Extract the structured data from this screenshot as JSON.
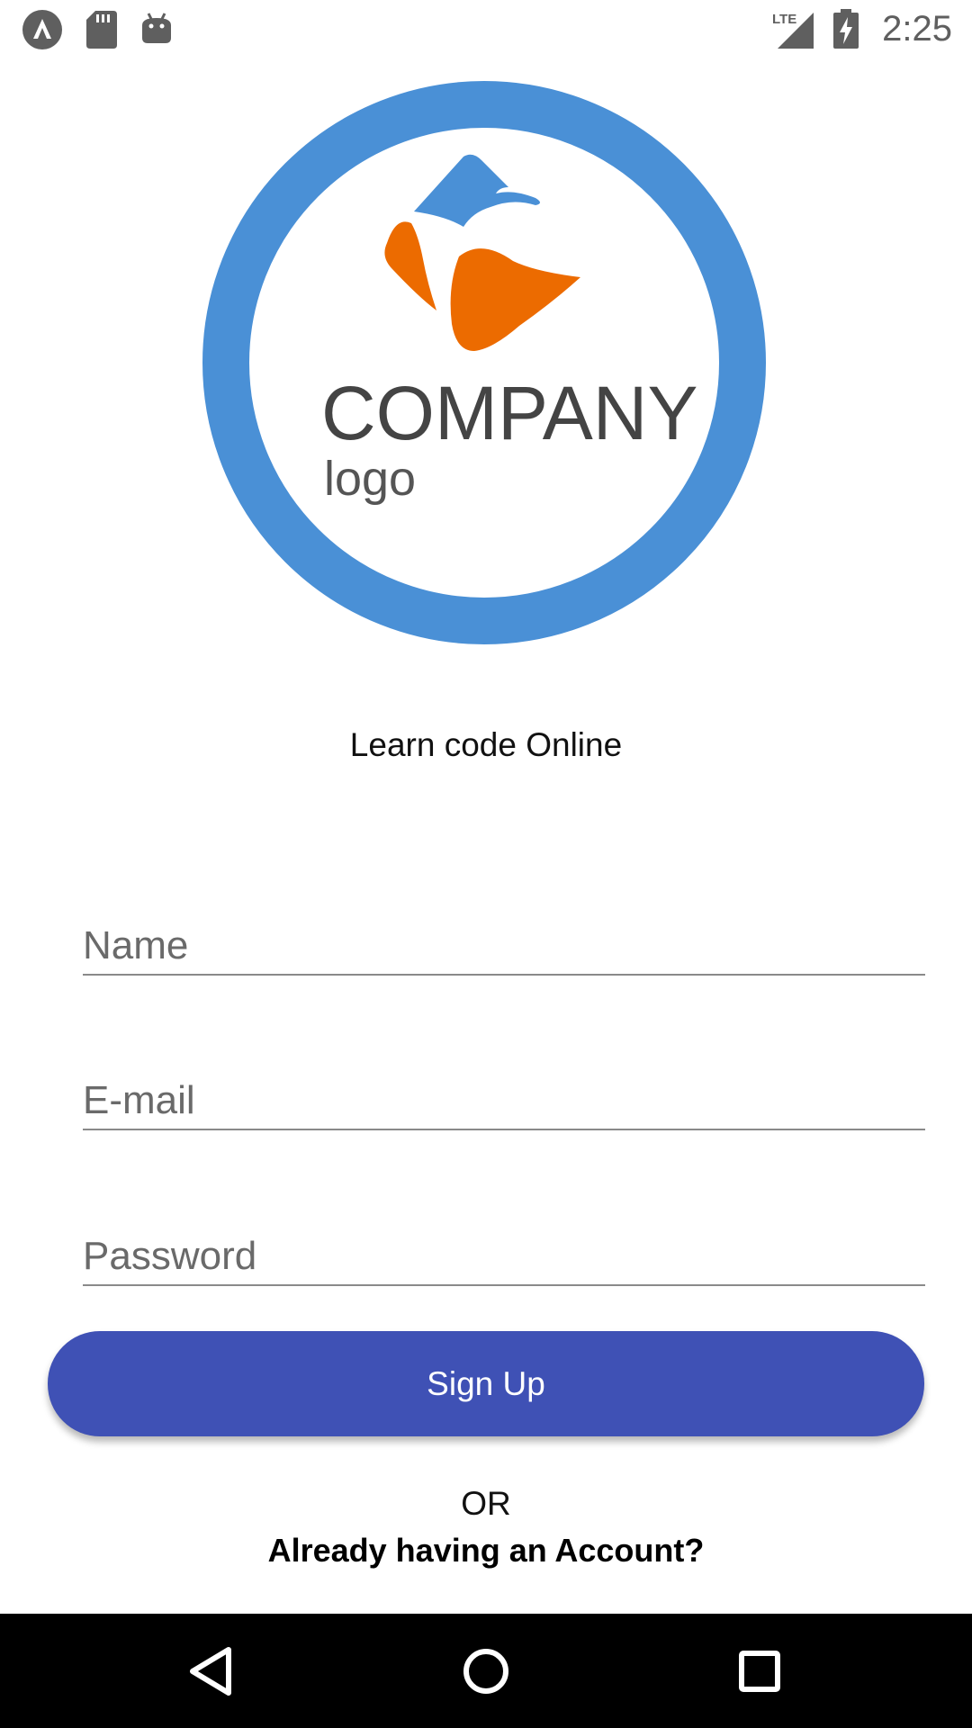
{
  "status_bar": {
    "time": "2:25",
    "network_label": "LTE",
    "icons": [
      "app-icon",
      "sd-card-icon",
      "android-debug-icon",
      "signal-icon",
      "battery-charging-icon"
    ]
  },
  "logo": {
    "company_text": "COMPANY",
    "sub_text": "logo",
    "colors": {
      "ring": "#4a90d6",
      "blue_shape": "#4a90d6",
      "orange_shape": "#ec6b00",
      "text": "#444444"
    }
  },
  "tagline": "Learn code Online",
  "form": {
    "name_placeholder": "Name",
    "email_placeholder": "E-mail",
    "password_placeholder": "Password",
    "signup_label": "Sign Up"
  },
  "footer": {
    "or_text": "OR",
    "login_prompt": "Already having an Account?"
  },
  "nav_bar": {
    "icons": [
      "back-icon",
      "home-icon",
      "recents-icon"
    ]
  },
  "colors": {
    "primary": "#3f51b5",
    "nav_background": "#000000"
  }
}
